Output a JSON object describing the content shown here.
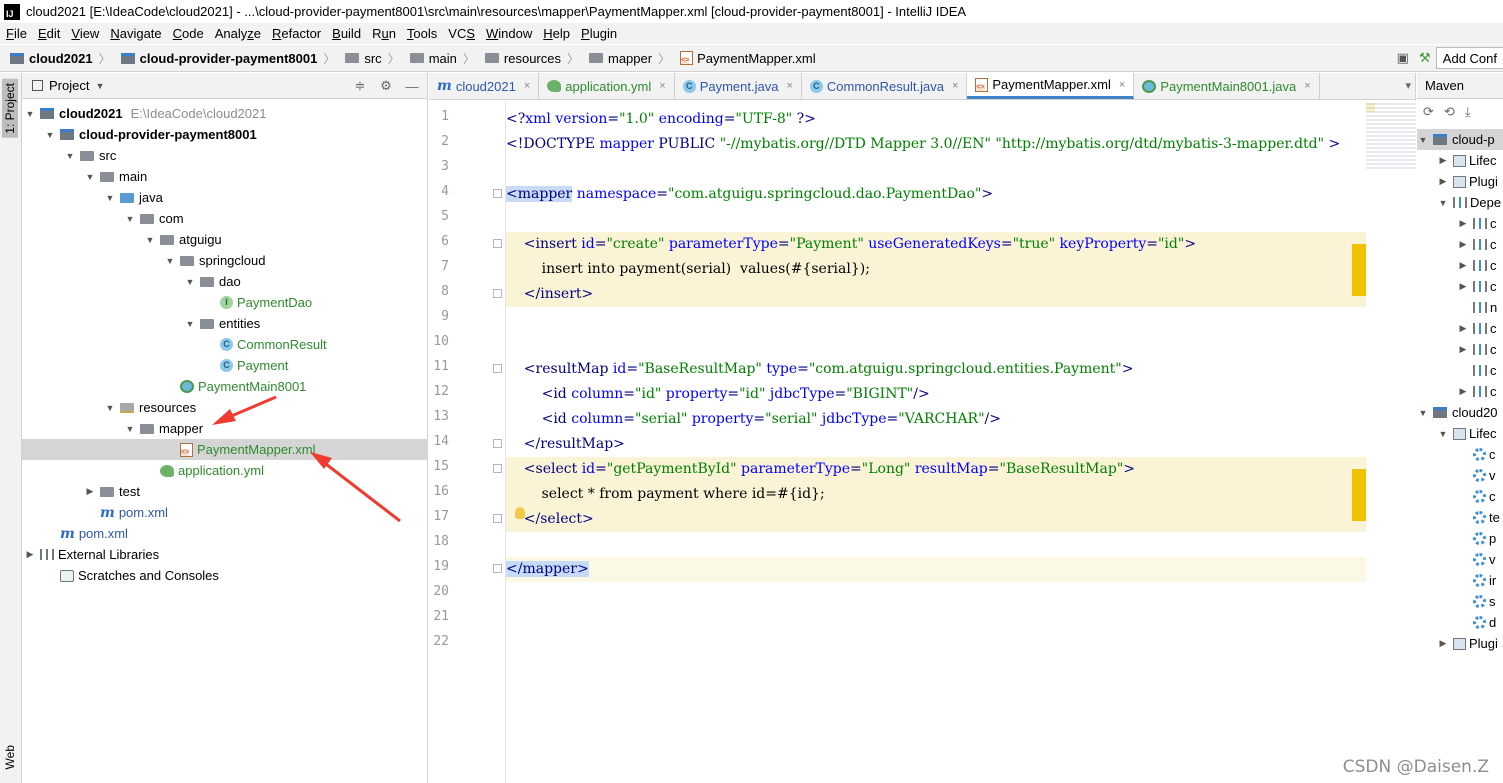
{
  "window": {
    "title": "cloud2021 [E:\\IdeaCode\\cloud2021] - ...\\cloud-provider-payment8001\\src\\main\\resources\\mapper\\PaymentMapper.xml [cloud-provider-payment8001] - IntelliJ IDEA",
    "logo": "IJ"
  },
  "menu": [
    {
      "u": "F",
      "rest": "ile"
    },
    {
      "u": "E",
      "rest": "dit"
    },
    {
      "u": "V",
      "rest": "iew"
    },
    {
      "u": "N",
      "rest": "avigate"
    },
    {
      "u": "C",
      "rest": "ode"
    },
    {
      "u": "",
      "pre": "Analy",
      "uu": "z",
      "post": "e"
    },
    {
      "u": "R",
      "rest": "efactor"
    },
    {
      "u": "B",
      "rest": "uild"
    },
    {
      "u": "",
      "pre": "R",
      "uu": "u",
      "post": "n"
    },
    {
      "u": "T",
      "rest": "ools"
    },
    {
      "u": "",
      "pre": "VC",
      "uu": "S",
      "post": ""
    },
    {
      "u": "W",
      "rest": "indow"
    },
    {
      "u": "H",
      "rest": "elp"
    },
    {
      "u": "P",
      "rest": "lugin"
    }
  ],
  "breadcrumbs": [
    "cloud2021",
    "cloud-provider-payment8001",
    "src",
    "main",
    "resources",
    "mapper",
    "PaymentMapper.xml"
  ],
  "navbar": {
    "add_config": "Add Conf"
  },
  "left_stripe": {
    "project_tab": "1: Project",
    "web_tab": "Web"
  },
  "project_panel": {
    "title": "Project",
    "tree": [
      {
        "label": "cloud2021",
        "hint": "E:\\IdeaCode\\cloud2021"
      },
      {
        "label": "cloud-provider-payment8001"
      },
      {
        "label": "src"
      },
      {
        "label": "main"
      },
      {
        "label": "java"
      },
      {
        "label": "com"
      },
      {
        "label": "atguigu"
      },
      {
        "label": "springcloud"
      },
      {
        "label": "dao"
      },
      {
        "label": "PaymentDao"
      },
      {
        "label": "entities"
      },
      {
        "label": "CommonResult"
      },
      {
        "label": "Payment"
      },
      {
        "label": "PaymentMain8001"
      },
      {
        "label": "resources"
      },
      {
        "label": "mapper"
      },
      {
        "label": "PaymentMapper.xml"
      },
      {
        "label": "application.yml"
      },
      {
        "label": "test"
      },
      {
        "label": "pom.xml"
      },
      {
        "label": "pom.xml"
      },
      {
        "label": "External Libraries"
      },
      {
        "label": "Scratches and Consoles"
      }
    ]
  },
  "editor": {
    "tabs": [
      {
        "label": "cloud2021",
        "icon": "m"
      },
      {
        "label": "application.yml",
        "icon": "yml"
      },
      {
        "label": "Payment.java",
        "icon": "c"
      },
      {
        "label": "CommonResult.java",
        "icon": "c"
      },
      {
        "label": "PaymentMapper.xml",
        "icon": "xml",
        "active": true
      },
      {
        "label": "PaymentMain8001.java",
        "icon": "main"
      }
    ],
    "tab_overflow": "▾",
    "line_numbers": [
      "1",
      "2",
      "3",
      "4",
      "5",
      "6",
      "7",
      "8",
      "9",
      "10",
      "11",
      "12",
      "13",
      "14",
      "15",
      "16",
      "17",
      "18",
      "19",
      "20",
      "21",
      "22"
    ],
    "code": [
      {
        "line": 1,
        "tokens": [
          [
            "t",
            "<?"
          ],
          [
            "a",
            "xml version"
          ],
          [
            "t",
            "="
          ],
          [
            "v",
            "\"1.0\""
          ],
          [
            "a",
            " encoding"
          ],
          [
            "t",
            "="
          ],
          [
            "v",
            "\"UTF-8\""
          ],
          [
            "t",
            " ?>"
          ]
        ]
      },
      {
        "line": 2,
        "tokens": [
          [
            "t",
            "<!DOCTYPE "
          ],
          [
            "a",
            "mapper"
          ],
          [
            "t",
            " PUBLIC "
          ],
          [
            "v",
            "\"-//mybatis.org//DTD Mapper 3.0//EN\""
          ],
          [
            "t",
            " "
          ],
          [
            "v",
            "\"http://mybatis.org/dtd/mybatis-3-mapper.dtd\""
          ],
          [
            "t",
            " >"
          ]
        ]
      },
      {
        "line": 4,
        "tokens": [
          [
            "h",
            "<mapper"
          ],
          [
            "a",
            " namespace"
          ],
          [
            "t",
            "="
          ],
          [
            "v",
            "\"com.atguigu.springcloud.dao.PaymentDao\""
          ],
          [
            "t",
            ">"
          ]
        ]
      },
      {
        "line": 6,
        "tokens": [
          [
            "t",
            "    <insert "
          ],
          [
            "a",
            "id"
          ],
          [
            "t",
            "="
          ],
          [
            "v",
            "\"create\""
          ],
          [
            "a",
            " parameterType"
          ],
          [
            "t",
            "="
          ],
          [
            "v",
            "\"Payment\""
          ],
          [
            "a",
            " useGeneratedKeys"
          ],
          [
            "t",
            "="
          ],
          [
            "v",
            "\"true\""
          ],
          [
            "a",
            " keyProperty"
          ],
          [
            "t",
            "="
          ],
          [
            "v",
            "\"id\""
          ],
          [
            "t",
            ">"
          ]
        ]
      },
      {
        "line": 7,
        "tokens": [
          [
            "x",
            "        insert into payment(serial)  values(#{serial});"
          ]
        ]
      },
      {
        "line": 8,
        "tokens": [
          [
            "t",
            "    </insert>"
          ]
        ]
      },
      {
        "line": 11,
        "tokens": [
          [
            "t",
            "    <resultMap "
          ],
          [
            "a",
            "id"
          ],
          [
            "t",
            "="
          ],
          [
            "v",
            "\"BaseResultMap\""
          ],
          [
            "a",
            " type"
          ],
          [
            "t",
            "="
          ],
          [
            "v",
            "\"com.atguigu.springcloud.entities.Payment\""
          ],
          [
            "t",
            ">"
          ]
        ]
      },
      {
        "line": 12,
        "tokens": [
          [
            "t",
            "        <id "
          ],
          [
            "a",
            "column"
          ],
          [
            "t",
            "="
          ],
          [
            "v",
            "\"id\""
          ],
          [
            "a",
            " property"
          ],
          [
            "t",
            "="
          ],
          [
            "v",
            "\"id\""
          ],
          [
            "a",
            " jdbcType"
          ],
          [
            "t",
            "="
          ],
          [
            "v",
            "\"BIGINT\""
          ],
          [
            "t",
            "/>"
          ]
        ]
      },
      {
        "line": 13,
        "tokens": [
          [
            "t",
            "        <id "
          ],
          [
            "a",
            "column"
          ],
          [
            "t",
            "="
          ],
          [
            "v",
            "\"serial\""
          ],
          [
            "a",
            " property"
          ],
          [
            "t",
            "="
          ],
          [
            "v",
            "\"serial\""
          ],
          [
            "a",
            " jdbcType"
          ],
          [
            "t",
            "="
          ],
          [
            "v",
            "\"VARCHAR\""
          ],
          [
            "t",
            "/>"
          ]
        ]
      },
      {
        "line": 14,
        "tokens": [
          [
            "t",
            "    </resultMap>"
          ]
        ]
      },
      {
        "line": 15,
        "tokens": [
          [
            "t",
            "    <select "
          ],
          [
            "a",
            "id"
          ],
          [
            "t",
            "="
          ],
          [
            "v",
            "\"getPaymentById\""
          ],
          [
            "a",
            " parameterType"
          ],
          [
            "t",
            "="
          ],
          [
            "v",
            "\"Long\""
          ],
          [
            "a",
            " resultMap"
          ],
          [
            "t",
            "="
          ],
          [
            "v",
            "\"BaseResultMap\""
          ],
          [
            "t",
            ">"
          ]
        ]
      },
      {
        "line": 16,
        "tokens": [
          [
            "x",
            "        select * from payment where id=#{id};"
          ]
        ]
      },
      {
        "line": 17,
        "tokens": [
          [
            "t",
            "    </select>"
          ]
        ]
      },
      {
        "line": 19,
        "tokens": [
          [
            "h",
            "</mapper>"
          ]
        ]
      }
    ]
  },
  "maven": {
    "title": "Maven",
    "rows": [
      {
        "label": "cloud-p"
      },
      {
        "label": "Lifec"
      },
      {
        "label": "Plugi"
      },
      {
        "label": "Depe"
      },
      {
        "label": "c"
      },
      {
        "label": "c"
      },
      {
        "label": "c"
      },
      {
        "label": "c"
      },
      {
        "label": "n"
      },
      {
        "label": "c"
      },
      {
        "label": "c"
      },
      {
        "label": "c"
      },
      {
        "label": "c"
      },
      {
        "label": "cloud20"
      },
      {
        "label": "Lifec"
      },
      {
        "label": "c"
      },
      {
        "label": "v"
      },
      {
        "label": "c"
      },
      {
        "label": "te"
      },
      {
        "label": "p"
      },
      {
        "label": "v"
      },
      {
        "label": "ir"
      },
      {
        "label": "s"
      },
      {
        "label": "d"
      },
      {
        "label": "Plugi"
      }
    ]
  },
  "watermark": "CSDN @Daisen.Z",
  "colors": {
    "annotation_arrow": "#f23b2f",
    "active_tab": "#4083c9",
    "string": "#008000",
    "attribute": "#0000ff",
    "tag": "#000080"
  }
}
